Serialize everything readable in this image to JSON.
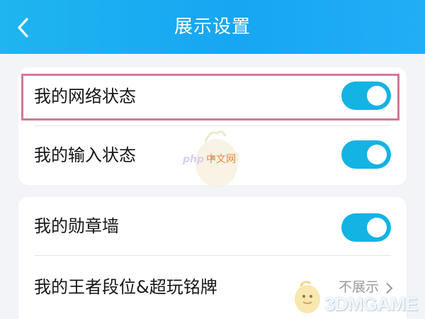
{
  "header": {
    "title": "展示设置",
    "back_icon": "chevron-left-icon"
  },
  "colors": {
    "header": "#17a6f2",
    "toggle_on": "#13b3e4",
    "highlight_border": "#d3779a",
    "background": "#f3f4f8"
  },
  "settings": {
    "group1": [
      {
        "label": "我的网络状态",
        "toggle": "on"
      },
      {
        "label": "我的输入状态",
        "toggle": "on"
      }
    ],
    "group2": [
      {
        "label": "我的勋章墙",
        "toggle": "on"
      },
      {
        "label": "我的王者段位&超玩铭牌",
        "value": "不展示"
      }
    ]
  },
  "watermarks": {
    "center": {
      "prefix": "php",
      "text": "中文网"
    },
    "bottom": {
      "text": "3DMGAME"
    }
  }
}
